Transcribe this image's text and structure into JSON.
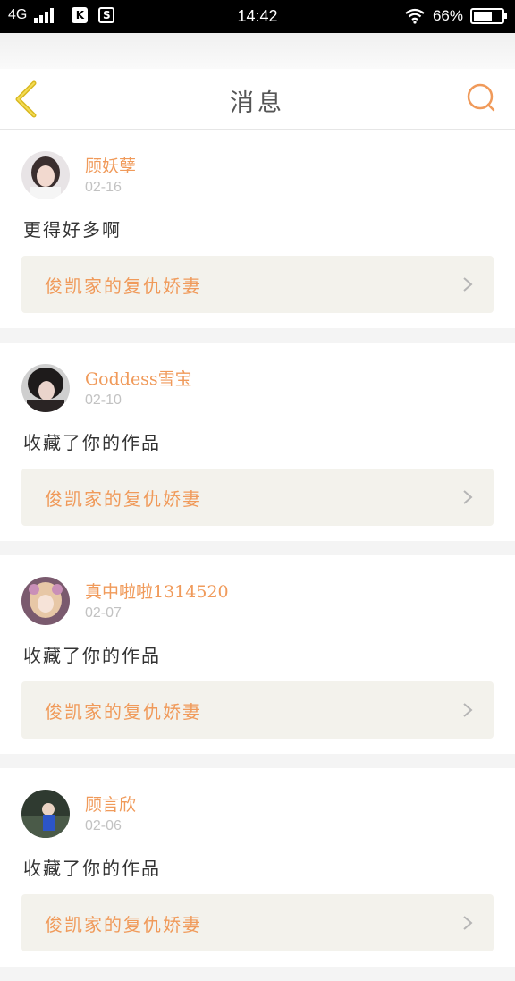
{
  "status_bar": {
    "network": "4G",
    "time": "14:42",
    "battery_percent": "66%",
    "battery_level": 0.66,
    "app_icons": [
      "K",
      "S"
    ]
  },
  "nav": {
    "title": "消息",
    "back_icon": "chevron-left-icon",
    "search_icon": "search-icon"
  },
  "colors": {
    "accent": "#f09a5a",
    "back_arrow": "#e8c72a",
    "link_bg": "#f3f2ec"
  },
  "messages": [
    {
      "username": "顾妖孽",
      "date": "02-16",
      "text": "更得好多啊",
      "work_title": "俊凯家的复仇娇妻"
    },
    {
      "username": "Goddess雪宝",
      "date": "02-10",
      "text": "收藏了你的作品",
      "work_title": "俊凯家的复仇娇妻"
    },
    {
      "username": "真中啦啦1314520",
      "date": "02-07",
      "text": "收藏了你的作品",
      "work_title": "俊凯家的复仇娇妻"
    },
    {
      "username": "顾言欣",
      "date": "02-06",
      "text": "收藏了你的作品",
      "work_title": "俊凯家的复仇娇妻"
    }
  ]
}
